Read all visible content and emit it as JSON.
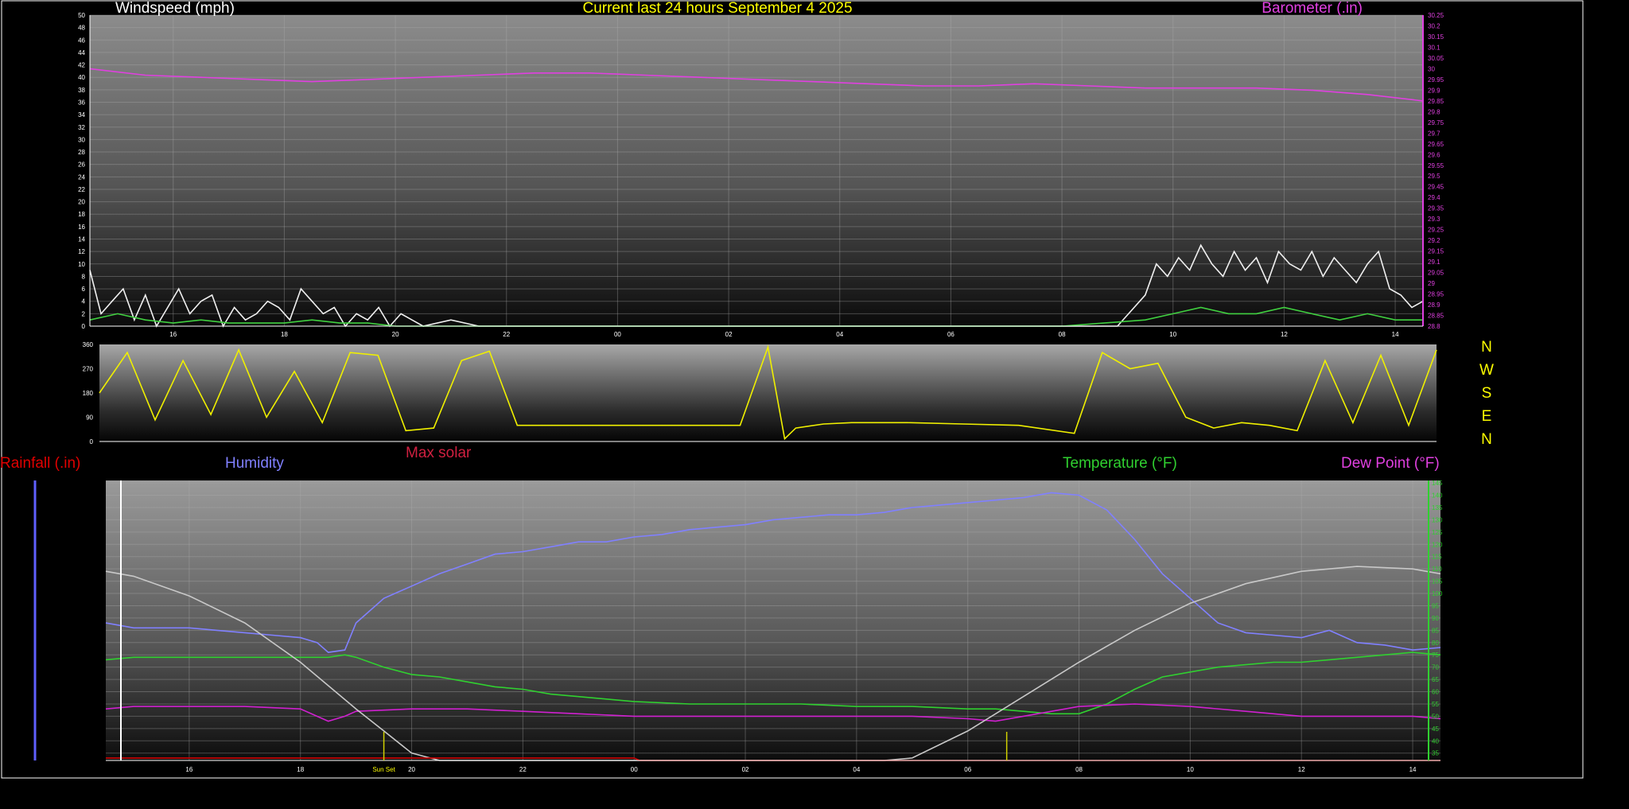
{
  "chart_data": [
    {
      "type": "line",
      "title": "Current last 24 hours September 4 2025",
      "ylabel": "Windspeed (mph)",
      "y2label": "Barometer (.in)",
      "grid": true,
      "x_ticks": [
        "16",
        "18",
        "20",
        "22",
        "00",
        "02",
        "04",
        "06",
        "08",
        "10",
        "12",
        "14"
      ],
      "y_ticks": [
        0,
        2,
        4,
        6,
        8,
        10,
        12,
        14,
        16,
        18,
        20,
        22,
        24,
        26,
        28,
        30,
        32,
        34,
        36,
        38,
        40,
        42,
        44,
        46,
        48,
        50
      ],
      "ylim": [
        0,
        50
      ],
      "y2_ticks": [
        "30.25",
        "30.2",
        "30.15",
        "30.1",
        "30.05",
        "30",
        "29.95",
        "29.9",
        "29.85",
        "29.8",
        "29.75",
        "29.7",
        "29.65",
        "29.6",
        "29.55",
        "29.5",
        "29.45",
        "29.4",
        "29.35",
        "29.3",
        "29.25",
        "29.2",
        "29.15",
        "29.1",
        "29.05",
        "29",
        "28.95",
        "28.9",
        "28.85",
        "28.8"
      ],
      "y2lim": [
        28.8,
        30.25
      ],
      "series": [
        {
          "name": "Barometer (.in)",
          "axis": "right",
          "color": "#e040e0",
          "x": [
            14.5,
            15.5,
            16.5,
            17.5,
            18.5,
            19.5,
            20.5,
            21.5,
            22.5,
            23.5,
            24.5,
            25.5,
            26.5,
            27.5,
            28.5,
            29.5,
            30.5,
            31.5,
            32.5,
            33.5,
            34.5,
            35.5,
            36.5,
            37.5,
            38.5
          ],
          "y": [
            30.0,
            29.97,
            29.96,
            29.95,
            29.94,
            29.95,
            29.96,
            29.97,
            29.98,
            29.98,
            29.97,
            29.96,
            29.95,
            29.94,
            29.93,
            29.92,
            29.92,
            29.93,
            29.92,
            29.91,
            29.91,
            29.91,
            29.9,
            29.88,
            29.85
          ]
        },
        {
          "name": "Wind gust",
          "color": "#f0f0f0",
          "x": [
            14.5,
            14.7,
            14.9,
            15.1,
            15.3,
            15.5,
            15.7,
            15.9,
            16.1,
            16.3,
            16.5,
            16.7,
            16.9,
            17.1,
            17.3,
            17.5,
            17.7,
            17.9,
            18.1,
            18.3,
            18.5,
            18.7,
            18.9,
            19.1,
            19.3,
            19.5,
            19.7,
            19.9,
            20.1,
            20.3,
            20.5,
            21.0,
            21.5,
            22.0,
            23.0,
            24.0,
            25.0,
            26.0,
            27.0,
            28.0,
            29.0,
            30.0,
            31.0,
            32.0,
            33.0,
            33.5,
            33.7,
            33.9,
            34.1,
            34.3,
            34.5,
            34.7,
            34.9,
            35.1,
            35.3,
            35.5,
            35.7,
            35.9,
            36.1,
            36.3,
            36.5,
            36.7,
            36.9,
            37.1,
            37.3,
            37.5,
            37.7,
            37.9,
            38.1,
            38.3,
            38.5
          ],
          "y": [
            9,
            2,
            4,
            6,
            1,
            5,
            0,
            3,
            6,
            2,
            4,
            5,
            0,
            3,
            1,
            2,
            4,
            3,
            1,
            6,
            4,
            2,
            3,
            0,
            2,
            1,
            3,
            0,
            2,
            1,
            0,
            1,
            0,
            0,
            0,
            0,
            0,
            0,
            0,
            0,
            0,
            0,
            0,
            0,
            0,
            5,
            10,
            8,
            11,
            9,
            13,
            10,
            8,
            12,
            9,
            11,
            7,
            12,
            10,
            9,
            12,
            8,
            11,
            9,
            7,
            10,
            12,
            6,
            5,
            3,
            4
          ]
        },
        {
          "name": "Wind speed",
          "color": "#40d040",
          "x": [
            14.5,
            15.0,
            15.5,
            16.0,
            16.5,
            17.0,
            17.5,
            18.0,
            18.5,
            19.0,
            19.5,
            20.0,
            21.0,
            22.0,
            24.0,
            26.0,
            28.0,
            30.0,
            32.0,
            33.5,
            34.0,
            34.5,
            35.0,
            35.5,
            36.0,
            36.5,
            37.0,
            37.5,
            38.0,
            38.5
          ],
          "y": [
            1,
            2,
            1,
            0.5,
            1,
            0.5,
            0.5,
            0.5,
            1,
            0.5,
            0.5,
            0,
            0,
            0,
            0,
            0,
            0,
            0,
            0,
            1,
            2,
            3,
            2,
            2,
            3,
            2,
            1,
            2,
            1,
            1
          ]
        }
      ]
    },
    {
      "type": "line",
      "x_ticks": [],
      "y_ticks": [
        0,
        90,
        180,
        270,
        360
      ],
      "ylim": [
        0,
        360
      ],
      "compass": [
        "N",
        "W",
        "S",
        "E",
        "N"
      ],
      "series": [
        {
          "name": "Wind direction",
          "color": "#f0f000",
          "x": [
            14.5,
            15.0,
            15.5,
            16.0,
            16.5,
            17.0,
            17.5,
            18.0,
            18.5,
            19.0,
            19.5,
            20.0,
            20.5,
            21.0,
            21.5,
            22.0,
            23.0,
            24.0,
            25.0,
            26.0,
            26.5,
            26.8,
            27.0,
            27.5,
            28.0,
            29.0,
            30.0,
            31.0,
            32.0,
            32.5,
            33.0,
            33.5,
            34.0,
            34.5,
            35.0,
            35.5,
            36.0,
            36.5,
            37.0,
            37.5,
            38.0,
            38.5
          ],
          "y": [
            180,
            330,
            80,
            300,
            100,
            340,
            90,
            260,
            70,
            330,
            320,
            40,
            50,
            300,
            335,
            60,
            60,
            60,
            60,
            60,
            350,
            10,
            50,
            65,
            70,
            70,
            65,
            60,
            30,
            330,
            270,
            290,
            90,
            50,
            70,
            60,
            40,
            300,
            70,
            320,
            60,
            340
          ]
        }
      ]
    },
    {
      "type": "line",
      "x_ticks": [
        "16",
        "18",
        "20",
        "22",
        "00",
        "02",
        "04",
        "06",
        "08",
        "10",
        "12",
        "14"
      ],
      "y2_ticks": [
        35,
        40,
        45,
        50,
        55,
        60,
        65,
        70,
        75,
        80,
        85,
        90,
        95,
        100,
        105,
        110,
        115,
        120,
        125,
        130,
        135,
        140,
        145
      ],
      "y2lim": [
        32,
        146
      ],
      "labels": {
        "rainfall": "Rainfall (.in)",
        "humidity": "Humidity",
        "solar": "Max solar",
        "temperature": "Temperature (°F)",
        "dewpoint": "Dew Point (°F)",
        "sunset": "Sun Set"
      },
      "series": [
        {
          "name": "Humidity",
          "color": "#8080ff",
          "x": [
            14.5,
            15.0,
            15.5,
            16.0,
            16.5,
            17.0,
            17.5,
            18.0,
            18.3,
            18.5,
            18.8,
            19.0,
            19.5,
            20.0,
            20.5,
            21.0,
            21.5,
            22.0,
            22.5,
            23.0,
            23.5,
            24.0,
            24.5,
            25.0,
            25.5,
            26.0,
            26.5,
            27.0,
            27.5,
            28.0,
            28.5,
            29.0,
            29.5,
            30.0,
            30.5,
            31.0,
            31.5,
            32.0,
            32.5,
            33.0,
            33.5,
            34.0,
            34.5,
            35.0,
            35.5,
            36.0,
            36.5,
            37.0,
            37.5,
            38.0,
            38.5
          ],
          "y": [
            88,
            86,
            86,
            86,
            85,
            84,
            83,
            82,
            80,
            76,
            77,
            88,
            98,
            103,
            108,
            112,
            116,
            117,
            119,
            121,
            121,
            123,
            124,
            126,
            127,
            128,
            130,
            131,
            132,
            132,
            133,
            135,
            136,
            137,
            138,
            139,
            141,
            140,
            134,
            122,
            108,
            98,
            88,
            84,
            83,
            82,
            85,
            80,
            79,
            77,
            78
          ]
        },
        {
          "name": "Temperature (°F)",
          "color": "#30d030",
          "x": [
            14.5,
            15.0,
            15.5,
            16.0,
            16.5,
            17.0,
            17.5,
            18.0,
            18.5,
            18.8,
            19.0,
            19.5,
            20.0,
            20.5,
            21.0,
            21.5,
            22.0,
            22.5,
            23.0,
            23.5,
            24.0,
            25.0,
            26.0,
            27.0,
            28.0,
            29.0,
            30.0,
            30.5,
            31.0,
            31.5,
            32.0,
            32.5,
            33.0,
            33.5,
            34.0,
            34.5,
            35.0,
            35.5,
            36.0,
            36.5,
            37.0,
            37.5,
            38.0,
            38.5
          ],
          "y": [
            73,
            74,
            74,
            74,
            74,
            74,
            74,
            74,
            74,
            75,
            74,
            70,
            67,
            66,
            64,
            62,
            61,
            59,
            58,
            57,
            56,
            55,
            55,
            55,
            54,
            54,
            53,
            53,
            52,
            51,
            51,
            55,
            61,
            66,
            68,
            70,
            71,
            72,
            72,
            73,
            74,
            75,
            76,
            75
          ]
        },
        {
          "name": "Dew Point (°F)",
          "color": "#d020d0",
          "x": [
            14.5,
            15.0,
            16.0,
            17.0,
            18.0,
            18.5,
            18.8,
            19.0,
            20.0,
            21.0,
            22.0,
            23.0,
            24.0,
            25.0,
            26.0,
            27.0,
            28.0,
            29.0,
            30.0,
            30.5,
            31.0,
            32.0,
            33.0,
            34.0,
            35.0,
            36.0,
            37.0,
            38.0,
            38.5
          ],
          "y": [
            53,
            54,
            54,
            54,
            53,
            48,
            50,
            52,
            53,
            53,
            52,
            51,
            50,
            50,
            50,
            50,
            50,
            50,
            49,
            48,
            50,
            54,
            55,
            54,
            52,
            50,
            50,
            50,
            49
          ]
        },
        {
          "name": "Max solar",
          "color": "#c8c8c8",
          "x": [
            14.5,
            15.0,
            16.0,
            17.0,
            18.0,
            19.0,
            19.5,
            20.0,
            20.5,
            21.0,
            28.5,
            29.0,
            30.0,
            31.0,
            32.0,
            33.0,
            34.0,
            35.0,
            36.0,
            37.0,
            38.0,
            38.5
          ],
          "y": [
            109,
            107,
            99,
            88,
            72,
            53,
            44,
            35,
            32,
            32,
            32,
            33,
            44,
            58,
            72,
            85,
            96,
            104,
            109,
            111,
            110,
            108
          ]
        },
        {
          "name": "Rainfall (.in)",
          "color": "#d00000",
          "x": [
            14.5,
            24.0,
            24.1,
            38.5
          ],
          "y": [
            33,
            33,
            32,
            32
          ]
        }
      ],
      "markers": [
        {
          "x": 19.5,
          "label": "Sun Set"
        },
        {
          "x": 30.7,
          "label": ""
        }
      ]
    }
  ]
}
